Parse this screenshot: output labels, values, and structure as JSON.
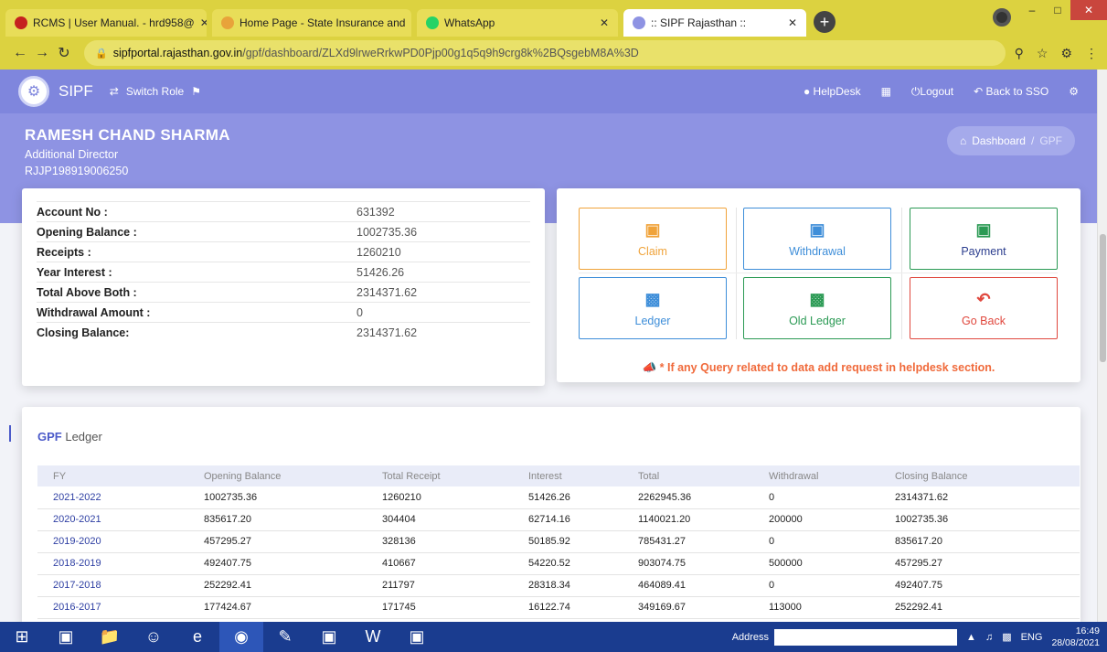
{
  "browser": {
    "tabs": [
      {
        "title": "RCMS | User Manual. - hrd958@",
        "icon_color": "#c5221f",
        "icon": "gmail-icon"
      },
      {
        "title": "Home Page - State Insurance and",
        "icon_color": "#e8a33a",
        "icon": "site-icon"
      },
      {
        "title": "WhatsApp",
        "icon_color": "#25d366",
        "icon": "whatsapp-icon"
      },
      {
        "title": ":: SIPF Rajasthan ::",
        "icon_color": "#8e93e3",
        "icon": "sipf-icon"
      }
    ],
    "url_host": "sipfportal.rajasthan.gov.in",
    "url_path": "/gpf/dashboard/ZLXd9lrweRrkwPD0Pjp00g1q5q9h9crg8k%2BQsgebM8A%3D"
  },
  "header": {
    "brand": "SIPF",
    "switch_role": "Switch Role",
    "helpdesk": "HelpDesk",
    "logout": "Logout",
    "back_to_sso": "Back to SSO"
  },
  "profile": {
    "name": "RAMESH CHAND SHARMA",
    "designation": "Additional Director",
    "employee_id": "RJJP198919006250"
  },
  "breadcrumb": {
    "home": "Dashboard",
    "separator": "/",
    "current": "GPF"
  },
  "account": [
    {
      "label": "Account No :",
      "value": "631392"
    },
    {
      "label": "Opening Balance :",
      "value": "1002735.36"
    },
    {
      "label": "Receipts :",
      "value": "1260210"
    },
    {
      "label": "Year Interest :",
      "value": "51426.26"
    },
    {
      "label": "Total Above Both :",
      "value": "2314371.62"
    },
    {
      "label": "Withdrawal Amount :",
      "value": "0"
    },
    {
      "label": "Closing Balance:",
      "value": "2314371.62"
    }
  ],
  "actions": {
    "claim": "Claim",
    "withdrawal": "Withdrawal",
    "payment": "Payment",
    "ledger": "Ledger",
    "old_ledger": "Old Ledger",
    "go_back": "Go Back",
    "notice": "* If any Query related to data add request in helpdesk section."
  },
  "ledger": {
    "title_bold": "GPF",
    "title_rest": " Ledger",
    "columns": [
      "FY",
      "Opening Balance",
      "Total Receipt",
      "Interest",
      "Total",
      "Withdrawal",
      "Closing Balance"
    ],
    "rows": [
      [
        "2021-2022",
        "1002735.36",
        "1260210",
        "51426.26",
        "2262945.36",
        "0",
        "2314371.62"
      ],
      [
        "2020-2021",
        "835617.20",
        "304404",
        "62714.16",
        "1140021.20",
        "200000",
        "1002735.36"
      ],
      [
        "2019-2020",
        "457295.27",
        "328136",
        "50185.92",
        "785431.27",
        "0",
        "835617.20"
      ],
      [
        "2018-2019",
        "492407.75",
        "410667",
        "54220.52",
        "903074.75",
        "500000",
        "457295.27"
      ],
      [
        "2017-2018",
        "252292.41",
        "211797",
        "28318.34",
        "464089.41",
        "0",
        "492407.75"
      ],
      [
        "2016-2017",
        "177424.67",
        "171745",
        "16122.74",
        "349169.67",
        "113000",
        "252292.41"
      ]
    ]
  },
  "taskbar": {
    "address_label": "Address",
    "lang": "ENG",
    "time": "16:49",
    "date": "28/08/2021"
  }
}
